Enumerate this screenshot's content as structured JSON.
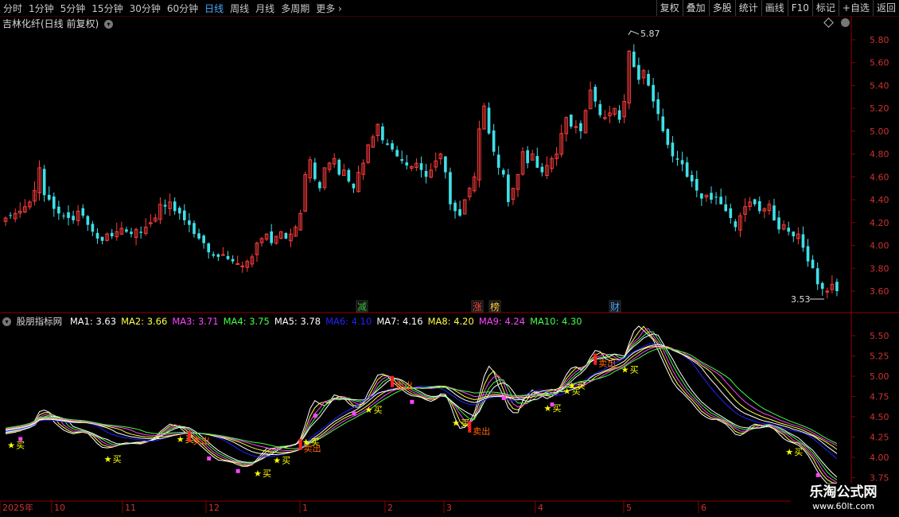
{
  "toolbar": {
    "periods": [
      {
        "label": "分时",
        "active": false
      },
      {
        "label": "1分钟",
        "active": false
      },
      {
        "label": "5分钟",
        "active": false
      },
      {
        "label": "15分钟",
        "active": false
      },
      {
        "label": "30分钟",
        "active": false
      },
      {
        "label": "60分钟",
        "active": false
      },
      {
        "label": "日线",
        "active": true
      },
      {
        "label": "周线",
        "active": false
      },
      {
        "label": "月线",
        "active": false
      },
      {
        "label": "多周期",
        "active": false
      },
      {
        "label": "更多",
        "active": false
      }
    ],
    "right_buttons": [
      "复权",
      "叠加",
      "多股",
      "统计",
      "画线",
      "F10",
      "标记",
      "+自选",
      "返回"
    ]
  },
  "main_title": "吉林化纤(日线 前复权)",
  "indicator": {
    "name": "股朋指标网",
    "mas": [
      {
        "label": "MA1: 3.63",
        "color": "#ffffff"
      },
      {
        "label": "MA2: 3.66",
        "color": "#ffff44"
      },
      {
        "label": "MA3: 3.71",
        "color": "#ff44ff"
      },
      {
        "label": "MA4: 3.75",
        "color": "#44ff44"
      },
      {
        "label": "MA5: 3.78",
        "color": "#ffffff"
      },
      {
        "label": "MA6: 4.10",
        "color": "#2222ff"
      },
      {
        "label": "MA7: 4.16",
        "color": "#ffffff"
      },
      {
        "label": "MA8: 4.20",
        "color": "#ffff44"
      },
      {
        "label": "MA9: 4.24",
        "color": "#ff44ff"
      },
      {
        "label": "MA10: 4.30",
        "color": "#44ff44"
      }
    ]
  },
  "events": [
    {
      "label": "减",
      "color": "#3ac23a"
    },
    {
      "label": "涨",
      "color": "#ff4444"
    },
    {
      "label": "榜",
      "color": "#ffcc44"
    },
    {
      "label": "财",
      "color": "#4aa8ff"
    }
  ],
  "signal_labels": {
    "buy": "买",
    "sell": "卖出",
    "alt_sell": "卖出"
  },
  "x_axis_labels": [
    "2025年",
    "10",
    "11",
    "12",
    "1",
    "2",
    "3",
    "4",
    "5",
    "6"
  ],
  "logo": {
    "line1": "乐淘公式网",
    "line2": "www.60lt.com"
  },
  "chart_data": [
    {
      "type": "candlestick",
      "title": "吉林化纤(日线 前复权)",
      "y_ticks": [
        5.8,
        5.6,
        5.4,
        5.2,
        5.0,
        4.8,
        4.6,
        4.4,
        4.2,
        4.0,
        3.8,
        3.6
      ],
      "ylim": [
        3.5,
        5.92
      ],
      "annotations": [
        {
          "label": "5.87",
          "value": 5.87
        },
        {
          "label": "3.53",
          "value": 3.53
        }
      ],
      "closes": [
        4.24,
        4.26,
        4.28,
        4.3,
        4.34,
        4.38,
        4.48,
        4.68,
        4.44,
        4.4,
        4.32,
        4.28,
        4.26,
        4.24,
        4.22,
        4.3,
        4.26,
        4.18,
        4.12,
        4.06,
        4.04,
        4.1,
        4.08,
        4.12,
        4.15,
        4.12,
        4.1,
        4.14,
        4.11,
        4.16,
        4.2,
        4.24,
        4.36,
        4.34,
        4.38,
        4.3,
        4.28,
        4.22,
        4.18,
        4.1,
        4.06,
        4.02,
        3.94,
        3.91,
        3.9,
        3.92,
        3.88,
        3.86,
        3.84,
        3.82,
        3.86,
        3.9,
        4.02,
        4.06,
        4.1,
        4.02,
        4.08,
        4.12,
        4.06,
        4.1,
        4.16,
        4.28,
        4.62,
        4.75,
        4.58,
        4.5,
        4.68,
        4.72,
        4.76,
        4.62,
        4.66,
        4.56,
        4.5,
        4.64,
        4.72,
        4.88,
        4.95,
        5.06,
        4.92,
        4.88,
        4.84,
        4.78,
        4.74,
        4.7,
        4.69,
        4.72,
        4.66,
        4.6,
        4.66,
        4.74,
        4.8,
        4.64,
        4.36,
        4.3,
        4.26,
        4.4,
        4.5,
        4.6,
        5.02,
        5.22,
        4.98,
        4.82,
        4.68,
        4.62,
        4.38,
        4.5,
        4.62,
        4.82,
        4.72,
        4.8,
        4.68,
        4.64,
        4.7,
        4.76,
        4.8,
        4.98,
        5.12,
        5.04,
        5.04,
        5.0,
        5.18,
        5.36,
        5.26,
        5.14,
        5.12,
        5.16,
        5.2,
        5.1,
        5.26,
        5.7,
        5.56,
        5.45,
        5.53,
        5.4,
        5.26,
        5.15,
        5.0,
        4.88,
        4.78,
        4.75,
        4.71,
        4.6,
        4.56,
        4.48,
        4.41,
        4.44,
        4.4,
        4.42,
        4.36,
        4.3,
        4.24,
        4.16,
        4.26,
        4.34,
        4.38,
        4.36,
        4.3,
        4.32,
        4.36,
        4.22,
        4.14,
        4.18,
        4.12,
        4.08,
        4.1,
        3.98,
        3.86,
        3.8,
        3.66,
        3.62,
        3.6,
        3.66,
        3.6
      ]
    },
    {
      "type": "line",
      "title": "股朋指标网",
      "y_ticks": [
        5.5,
        5.25,
        5.0,
        4.75,
        4.5,
        4.25,
        4.0,
        3.75
      ],
      "ylim": [
        3.72,
        5.62
      ],
      "series": [
        {
          "name": "MA1",
          "color": "#ffffff"
        },
        {
          "name": "MA2",
          "color": "#ffff44"
        },
        {
          "name": "MA3",
          "color": "#ff44ff"
        },
        {
          "name": "MA4",
          "color": "#44ff44"
        },
        {
          "name": "MA5",
          "color": "#ffffff"
        },
        {
          "name": "MA6",
          "color": "#2222ff"
        },
        {
          "name": "MA7",
          "color": "#ffffff"
        },
        {
          "name": "MA8",
          "color": "#ffff44"
        },
        {
          "name": "MA9",
          "color": "#ff44ff"
        },
        {
          "name": "MA10",
          "color": "#44ff44"
        }
      ],
      "buy_signals": [
        1,
        21,
        36,
        52,
        56,
        62,
        75,
        93,
        112,
        116,
        117,
        128,
        162
      ],
      "sell_signals": [
        38,
        61,
        80,
        96,
        122
      ],
      "magenta_dots": [
        3,
        42,
        48,
        64,
        72,
        84,
        103,
        113,
        168
      ]
    }
  ]
}
